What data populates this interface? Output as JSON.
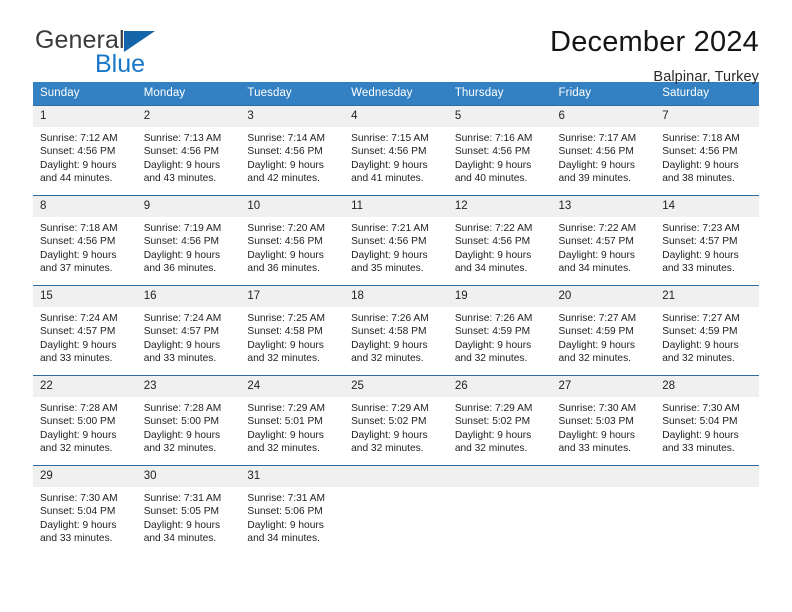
{
  "brand": {
    "name_top": "General",
    "name_bottom": "Blue",
    "triangle_icon": "triangle-icon",
    "color_dark": "#3c3c3c",
    "color_blue": "#1878c8"
  },
  "header": {
    "title": "December 2024",
    "subtitle": "Balpinar, Turkey"
  },
  "theme": {
    "header_bar": "#3380c2",
    "row_border": "#2e6da4",
    "daynum_band": "#f0f0f0"
  },
  "weekdays": [
    "Sunday",
    "Monday",
    "Tuesday",
    "Wednesday",
    "Thursday",
    "Friday",
    "Saturday"
  ],
  "weeks": [
    [
      {
        "day": "1",
        "sunrise": "Sunrise: 7:12 AM",
        "sunset": "Sunset: 4:56 PM",
        "daylight1": "Daylight: 9 hours",
        "daylight2": "and 44 minutes."
      },
      {
        "day": "2",
        "sunrise": "Sunrise: 7:13 AM",
        "sunset": "Sunset: 4:56 PM",
        "daylight1": "Daylight: 9 hours",
        "daylight2": "and 43 minutes."
      },
      {
        "day": "3",
        "sunrise": "Sunrise: 7:14 AM",
        "sunset": "Sunset: 4:56 PM",
        "daylight1": "Daylight: 9 hours",
        "daylight2": "and 42 minutes."
      },
      {
        "day": "4",
        "sunrise": "Sunrise: 7:15 AM",
        "sunset": "Sunset: 4:56 PM",
        "daylight1": "Daylight: 9 hours",
        "daylight2": "and 41 minutes."
      },
      {
        "day": "5",
        "sunrise": "Sunrise: 7:16 AM",
        "sunset": "Sunset: 4:56 PM",
        "daylight1": "Daylight: 9 hours",
        "daylight2": "and 40 minutes."
      },
      {
        "day": "6",
        "sunrise": "Sunrise: 7:17 AM",
        "sunset": "Sunset: 4:56 PM",
        "daylight1": "Daylight: 9 hours",
        "daylight2": "and 39 minutes."
      },
      {
        "day": "7",
        "sunrise": "Sunrise: 7:18 AM",
        "sunset": "Sunset: 4:56 PM",
        "daylight1": "Daylight: 9 hours",
        "daylight2": "and 38 minutes."
      }
    ],
    [
      {
        "day": "8",
        "sunrise": "Sunrise: 7:18 AM",
        "sunset": "Sunset: 4:56 PM",
        "daylight1": "Daylight: 9 hours",
        "daylight2": "and 37 minutes."
      },
      {
        "day": "9",
        "sunrise": "Sunrise: 7:19 AM",
        "sunset": "Sunset: 4:56 PM",
        "daylight1": "Daylight: 9 hours",
        "daylight2": "and 36 minutes."
      },
      {
        "day": "10",
        "sunrise": "Sunrise: 7:20 AM",
        "sunset": "Sunset: 4:56 PM",
        "daylight1": "Daylight: 9 hours",
        "daylight2": "and 36 minutes."
      },
      {
        "day": "11",
        "sunrise": "Sunrise: 7:21 AM",
        "sunset": "Sunset: 4:56 PM",
        "daylight1": "Daylight: 9 hours",
        "daylight2": "and 35 minutes."
      },
      {
        "day": "12",
        "sunrise": "Sunrise: 7:22 AM",
        "sunset": "Sunset: 4:56 PM",
        "daylight1": "Daylight: 9 hours",
        "daylight2": "and 34 minutes."
      },
      {
        "day": "13",
        "sunrise": "Sunrise: 7:22 AM",
        "sunset": "Sunset: 4:57 PM",
        "daylight1": "Daylight: 9 hours",
        "daylight2": "and 34 minutes."
      },
      {
        "day": "14",
        "sunrise": "Sunrise: 7:23 AM",
        "sunset": "Sunset: 4:57 PM",
        "daylight1": "Daylight: 9 hours",
        "daylight2": "and 33 minutes."
      }
    ],
    [
      {
        "day": "15",
        "sunrise": "Sunrise: 7:24 AM",
        "sunset": "Sunset: 4:57 PM",
        "daylight1": "Daylight: 9 hours",
        "daylight2": "and 33 minutes."
      },
      {
        "day": "16",
        "sunrise": "Sunrise: 7:24 AM",
        "sunset": "Sunset: 4:57 PM",
        "daylight1": "Daylight: 9 hours",
        "daylight2": "and 33 minutes."
      },
      {
        "day": "17",
        "sunrise": "Sunrise: 7:25 AM",
        "sunset": "Sunset: 4:58 PM",
        "daylight1": "Daylight: 9 hours",
        "daylight2": "and 32 minutes."
      },
      {
        "day": "18",
        "sunrise": "Sunrise: 7:26 AM",
        "sunset": "Sunset: 4:58 PM",
        "daylight1": "Daylight: 9 hours",
        "daylight2": "and 32 minutes."
      },
      {
        "day": "19",
        "sunrise": "Sunrise: 7:26 AM",
        "sunset": "Sunset: 4:59 PM",
        "daylight1": "Daylight: 9 hours",
        "daylight2": "and 32 minutes."
      },
      {
        "day": "20",
        "sunrise": "Sunrise: 7:27 AM",
        "sunset": "Sunset: 4:59 PM",
        "daylight1": "Daylight: 9 hours",
        "daylight2": "and 32 minutes."
      },
      {
        "day": "21",
        "sunrise": "Sunrise: 7:27 AM",
        "sunset": "Sunset: 4:59 PM",
        "daylight1": "Daylight: 9 hours",
        "daylight2": "and 32 minutes."
      }
    ],
    [
      {
        "day": "22",
        "sunrise": "Sunrise: 7:28 AM",
        "sunset": "Sunset: 5:00 PM",
        "daylight1": "Daylight: 9 hours",
        "daylight2": "and 32 minutes."
      },
      {
        "day": "23",
        "sunrise": "Sunrise: 7:28 AM",
        "sunset": "Sunset: 5:00 PM",
        "daylight1": "Daylight: 9 hours",
        "daylight2": "and 32 minutes."
      },
      {
        "day": "24",
        "sunrise": "Sunrise: 7:29 AM",
        "sunset": "Sunset: 5:01 PM",
        "daylight1": "Daylight: 9 hours",
        "daylight2": "and 32 minutes."
      },
      {
        "day": "25",
        "sunrise": "Sunrise: 7:29 AM",
        "sunset": "Sunset: 5:02 PM",
        "daylight1": "Daylight: 9 hours",
        "daylight2": "and 32 minutes."
      },
      {
        "day": "26",
        "sunrise": "Sunrise: 7:29 AM",
        "sunset": "Sunset: 5:02 PM",
        "daylight1": "Daylight: 9 hours",
        "daylight2": "and 32 minutes."
      },
      {
        "day": "27",
        "sunrise": "Sunrise: 7:30 AM",
        "sunset": "Sunset: 5:03 PM",
        "daylight1": "Daylight: 9 hours",
        "daylight2": "and 33 minutes."
      },
      {
        "day": "28",
        "sunrise": "Sunrise: 7:30 AM",
        "sunset": "Sunset: 5:04 PM",
        "daylight1": "Daylight: 9 hours",
        "daylight2": "and 33 minutes."
      }
    ],
    [
      {
        "day": "29",
        "sunrise": "Sunrise: 7:30 AM",
        "sunset": "Sunset: 5:04 PM",
        "daylight1": "Daylight: 9 hours",
        "daylight2": "and 33 minutes."
      },
      {
        "day": "30",
        "sunrise": "Sunrise: 7:31 AM",
        "sunset": "Sunset: 5:05 PM",
        "daylight1": "Daylight: 9 hours",
        "daylight2": "and 34 minutes."
      },
      {
        "day": "31",
        "sunrise": "Sunrise: 7:31 AM",
        "sunset": "Sunset: 5:06 PM",
        "daylight1": "Daylight: 9 hours",
        "daylight2": "and 34 minutes."
      },
      {
        "day": "",
        "sunrise": "",
        "sunset": "",
        "daylight1": "",
        "daylight2": ""
      },
      {
        "day": "",
        "sunrise": "",
        "sunset": "",
        "daylight1": "",
        "daylight2": ""
      },
      {
        "day": "",
        "sunrise": "",
        "sunset": "",
        "daylight1": "",
        "daylight2": ""
      },
      {
        "day": "",
        "sunrise": "",
        "sunset": "",
        "daylight1": "",
        "daylight2": ""
      }
    ]
  ]
}
